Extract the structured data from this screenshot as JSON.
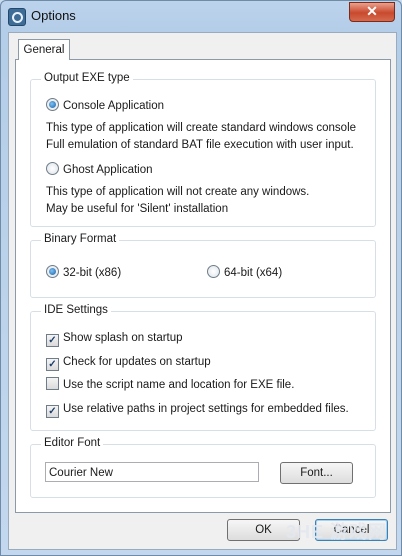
{
  "window": {
    "title": "Options",
    "close_glyph": "✕"
  },
  "tabs": [
    {
      "label": "General"
    }
  ],
  "output_exe": {
    "title": "Output EXE type",
    "console_label": "Console Application",
    "console_desc_1": "This type of application will create standard windows console",
    "console_desc_2": "Full emulation of standard BAT file execution with user input.",
    "ghost_label": "Ghost Application",
    "ghost_desc_1": "This type of application will not create any windows.",
    "ghost_desc_2": "May be useful for 'Silent' installation",
    "selected": "Console Application"
  },
  "binary_format": {
    "title": "Binary Format",
    "opt_32": "32-bit (x86)",
    "opt_64": "64-bit (x64)",
    "selected": "32-bit (x86)"
  },
  "ide_settings": {
    "title": "IDE Settings",
    "items": [
      {
        "label": "Show splash on startup",
        "checked": true
      },
      {
        "label": "Check for updates on startup",
        "checked": true
      },
      {
        "label": "Use the script name and location for EXE file.",
        "checked": false
      },
      {
        "label": "Use relative paths in project settings for embedded files.",
        "checked": true
      }
    ]
  },
  "editor_font": {
    "title": "Editor Font",
    "value": "Courier New",
    "font_button": "Font..."
  },
  "buttons": {
    "ok": "OK",
    "cancel": "Cancel"
  },
  "watermark": "3HE 游戏网"
}
